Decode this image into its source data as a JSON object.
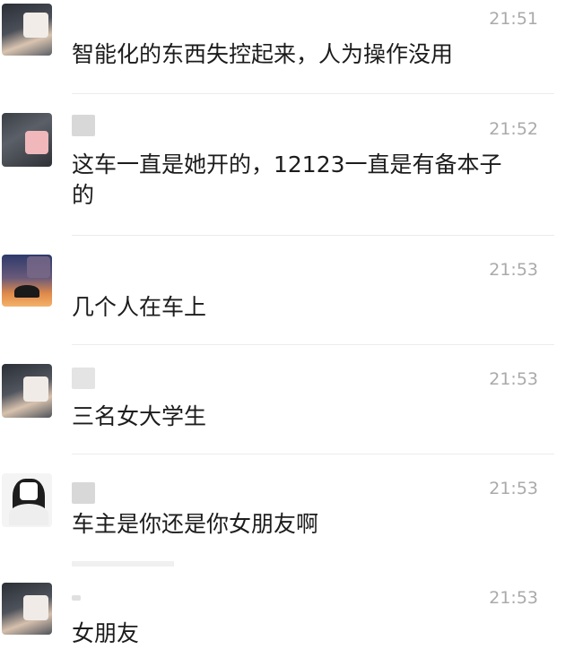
{
  "colors": {
    "background": "#ffffff",
    "text": "#1c1c1c",
    "timestamp": "#aaaaaa",
    "divider": "#ececec",
    "name_redaction": "#d8d8d8"
  },
  "messages": [
    {
      "time": "21:51",
      "text": "智能化的东西失控起来，人为操作没用",
      "avatar": "avatar-dark-portrait"
    },
    {
      "time": "21:52",
      "text": "这车一直是她开的，12123一直是有备本子的",
      "avatar": "avatar-pink-blur"
    },
    {
      "time": "21:53",
      "text": "几个人在车上",
      "avatar": "avatar-sunset"
    },
    {
      "time": "21:53",
      "text": "三名女大学生",
      "avatar": "avatar-dark-portrait"
    },
    {
      "time": "21:53",
      "text": "车主是你还是你女朋友啊",
      "avatar": "avatar-white-figure"
    },
    {
      "time": "21:53",
      "text": "女朋友",
      "avatar": "avatar-dark-portrait"
    }
  ]
}
